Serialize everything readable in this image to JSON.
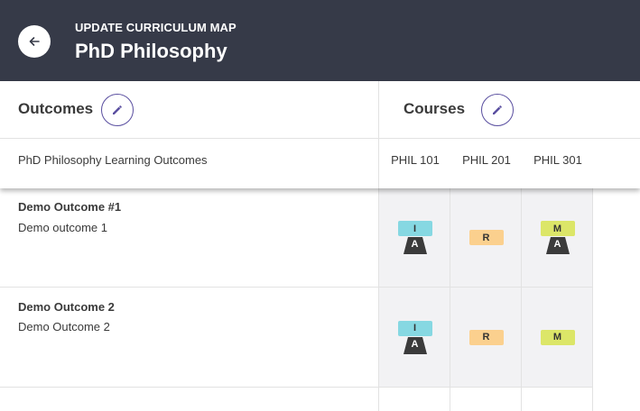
{
  "header": {
    "subtitle": "UPDATE CURRICULUM MAP",
    "title": "PhD Philosophy",
    "background": "#363a48"
  },
  "sections": {
    "outcomes_title": "Outcomes",
    "courses_title": "Courses"
  },
  "table": {
    "outcomes_header": "PhD Philosophy Learning Outcomes",
    "courses": [
      "PHIL 101",
      "PHIL 201",
      "PHIL 301"
    ],
    "rows": [
      {
        "title": "Demo Outcome #1",
        "description": "Demo outcome 1",
        "cells": [
          {
            "top": "I",
            "bottom": "A"
          },
          {
            "top": "R",
            "bottom": ""
          },
          {
            "top": "M",
            "bottom": "A"
          }
        ]
      },
      {
        "title": "Demo Outcome 2",
        "description": "Demo Outcome 2",
        "cells": [
          {
            "top": "I",
            "bottom": "A"
          },
          {
            "top": "R",
            "bottom": ""
          },
          {
            "top": "M",
            "bottom": ""
          }
        ]
      }
    ]
  },
  "colors": {
    "introduced": "#86d8e2",
    "reinforced": "#fbd08e",
    "mastered": "#dce668",
    "assessed": "#3b3b3b",
    "accent": "#5a4fa0"
  },
  "icons": {
    "back": "arrow-left-icon",
    "edit": "pencil-icon"
  }
}
